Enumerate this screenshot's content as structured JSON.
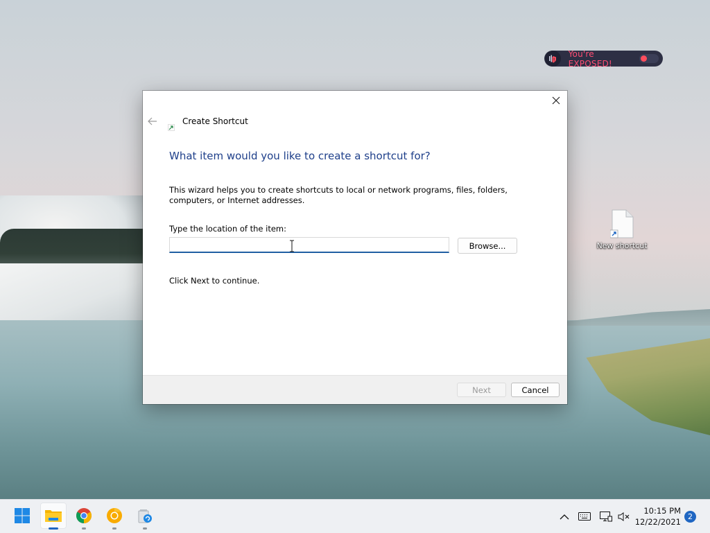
{
  "desktop": {
    "exposed_badge": {
      "text": "You're EXPOSED!"
    },
    "icons": [
      {
        "label": "New shortcut",
        "icon": "shortcut-file-icon"
      }
    ]
  },
  "dialog": {
    "window_title": "Create Shortcut",
    "heading": "What item would you like to create a shortcut for?",
    "description": "This wizard helps you to create shortcuts to local or network programs, files, folders, computers, or Internet addresses.",
    "location_label": "Type the location of the item:",
    "location_value": "",
    "location_placeholder": "",
    "browse_label": "Browse...",
    "continue_text": "Click Next to continue.",
    "next_label": "Next",
    "cancel_label": "Cancel",
    "next_enabled": false
  },
  "taskbar": {
    "apps": [
      {
        "name": "Start",
        "icon": "windows-start-icon"
      },
      {
        "name": "File Explorer",
        "icon": "folder-icon",
        "active": true
      },
      {
        "name": "Google Chrome",
        "icon": "chrome-icon"
      },
      {
        "name": "Chrome Canary",
        "icon": "chrome-canary-icon"
      },
      {
        "name": "Disk Cleanup",
        "icon": "disk-cleanup-icon"
      }
    ],
    "tray": {
      "icons": [
        "chevron-up-icon",
        "keyboard-icon",
        "network-icon",
        "volume-muted-icon"
      ],
      "time": "10:15 PM",
      "date": "12/22/2021",
      "notification_count": "2"
    }
  },
  "colors": {
    "heading": "#1e3f8a",
    "input_focus": "#1f5fa3",
    "exposed_text": "#ff4d73",
    "pill_bg": "#2d2f44",
    "accent": "#1f66c2"
  }
}
